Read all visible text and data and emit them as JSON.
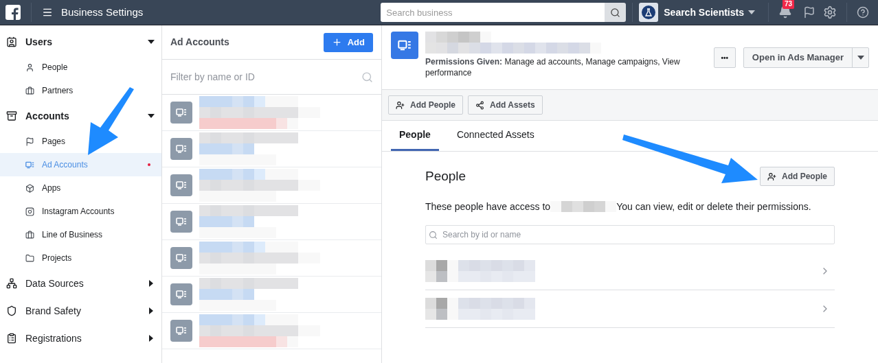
{
  "topbar": {
    "title": "Business Settings",
    "search": {
      "placeholder": "Search business"
    },
    "business": "Search Scientists",
    "notifications": "73"
  },
  "sidebar": [
    {
      "label": "Users",
      "expanded": true,
      "children": [
        {
          "label": "People",
          "selected": false,
          "alert": false
        },
        {
          "label": "Partners",
          "selected": false,
          "alert": false
        }
      ]
    },
    {
      "label": "Accounts",
      "expanded": true,
      "children": [
        {
          "label": "Pages",
          "selected": false,
          "alert": false
        },
        {
          "label": "Ad Accounts",
          "selected": true,
          "alert": true
        },
        {
          "label": "Apps",
          "selected": false,
          "alert": false
        },
        {
          "label": "Instagram Accounts",
          "selected": false,
          "alert": false
        },
        {
          "label": "Line of Business",
          "selected": false,
          "alert": false
        },
        {
          "label": "Projects",
          "selected": false,
          "alert": false
        }
      ]
    },
    {
      "label": "Data Sources",
      "expanded": false
    },
    {
      "label": "Brand Safety",
      "expanded": false
    },
    {
      "label": "Registrations",
      "expanded": false
    }
  ],
  "account_list": {
    "title": "Ad Accounts",
    "add_button": "Add",
    "filter": {
      "placeholder": "Filter by name or ID"
    },
    "rows": [
      {
        "flagged": true
      },
      {
        "flagged": false
      },
      {
        "flagged": false
      },
      {
        "flagged": false
      },
      {
        "flagged": false
      },
      {
        "flagged": false
      },
      {
        "flagged": true
      }
    ]
  },
  "detail": {
    "permissions": "**Permissions Given:** Manage ad accounts, Manage campaigns, View performance",
    "more_button": "•••",
    "open_button": "Open in Ads Manager",
    "toolbar": [
      {
        "label": "Add People",
        "kind": "people"
      },
      {
        "label": "Add Assets",
        "kind": "assets"
      }
    ],
    "tabs": [
      {
        "label": "People",
        "selected": true
      },
      {
        "label": "Connected Assets",
        "selected": false
      }
    ],
    "section": {
      "title": "People",
      "add_button": "Add People",
      "description_before": "These people have access to",
      "description_after": "You can view, edit or delete their permissions.",
      "search": {
        "placeholder": "Search by id or name"
      },
      "people": [
        {
          "redacted": true
        },
        {
          "redacted": true
        }
      ]
    }
  }
}
